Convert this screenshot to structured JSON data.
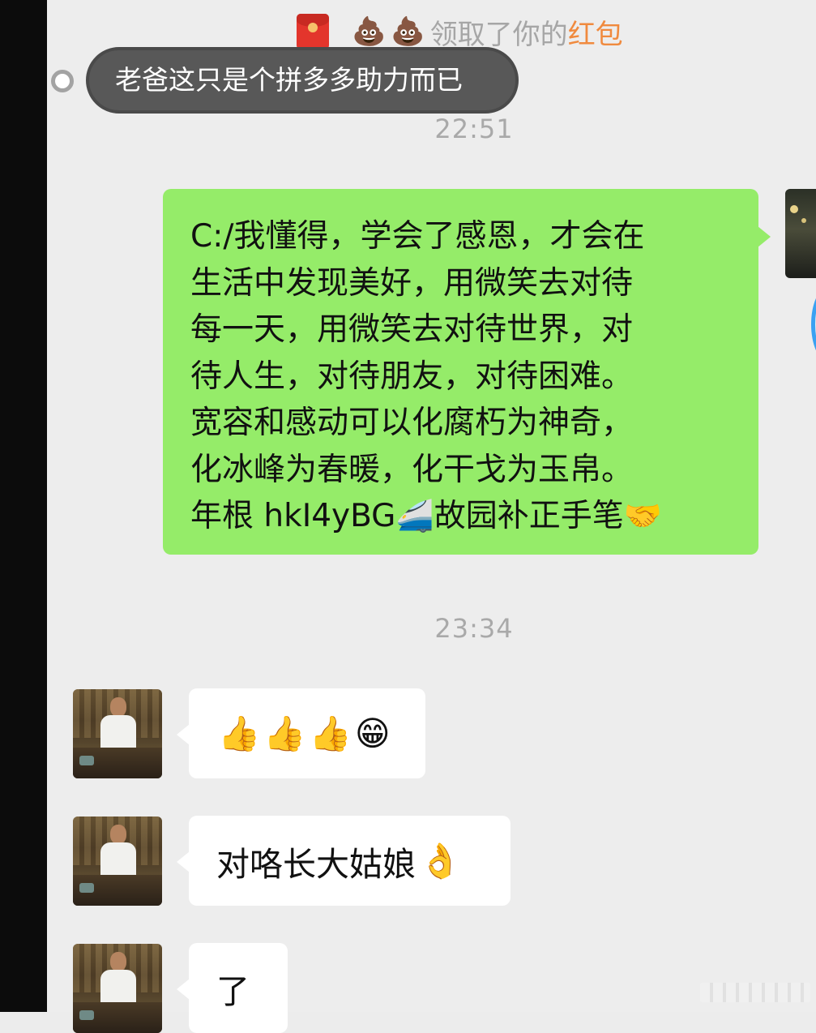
{
  "system_notice": {
    "icon": "red-packet-icon",
    "emojis": [
      "💩",
      "💩"
    ],
    "text_prefix": "领取了你的",
    "text_highlight": "红包",
    "highlight_color": "#f08a3e"
  },
  "quoted_message": {
    "text": "老爸这只是个拼多多助力而已"
  },
  "timestamps": [
    "22:51",
    "23:34"
  ],
  "my_message": {
    "lines": [
      "C:/我懂得，学会了感恩，才会在",
      "生活中发现美好，用微笑去对待",
      "每一天，用微笑去对待世界，对",
      "待人生，对待朋友，对待困难。",
      "宽容和感动可以化腐朽为神奇，",
      "化冰峰为春暖，化干戈为玉帛。"
    ],
    "last_line_start": "年根 hkI4yBG",
    "last_line_emoji_1": "🚄",
    "last_line_end": "故园补正手笔",
    "last_line_emoji_2": "🤝",
    "bubble_color": "#95ec69"
  },
  "friend_messages": [
    {
      "emojis": [
        "👍",
        "👍",
        "👍",
        "😁"
      ]
    },
    {
      "text": "对咯长大姑娘",
      "emoji": "👌"
    },
    {
      "text": "了"
    }
  ]
}
